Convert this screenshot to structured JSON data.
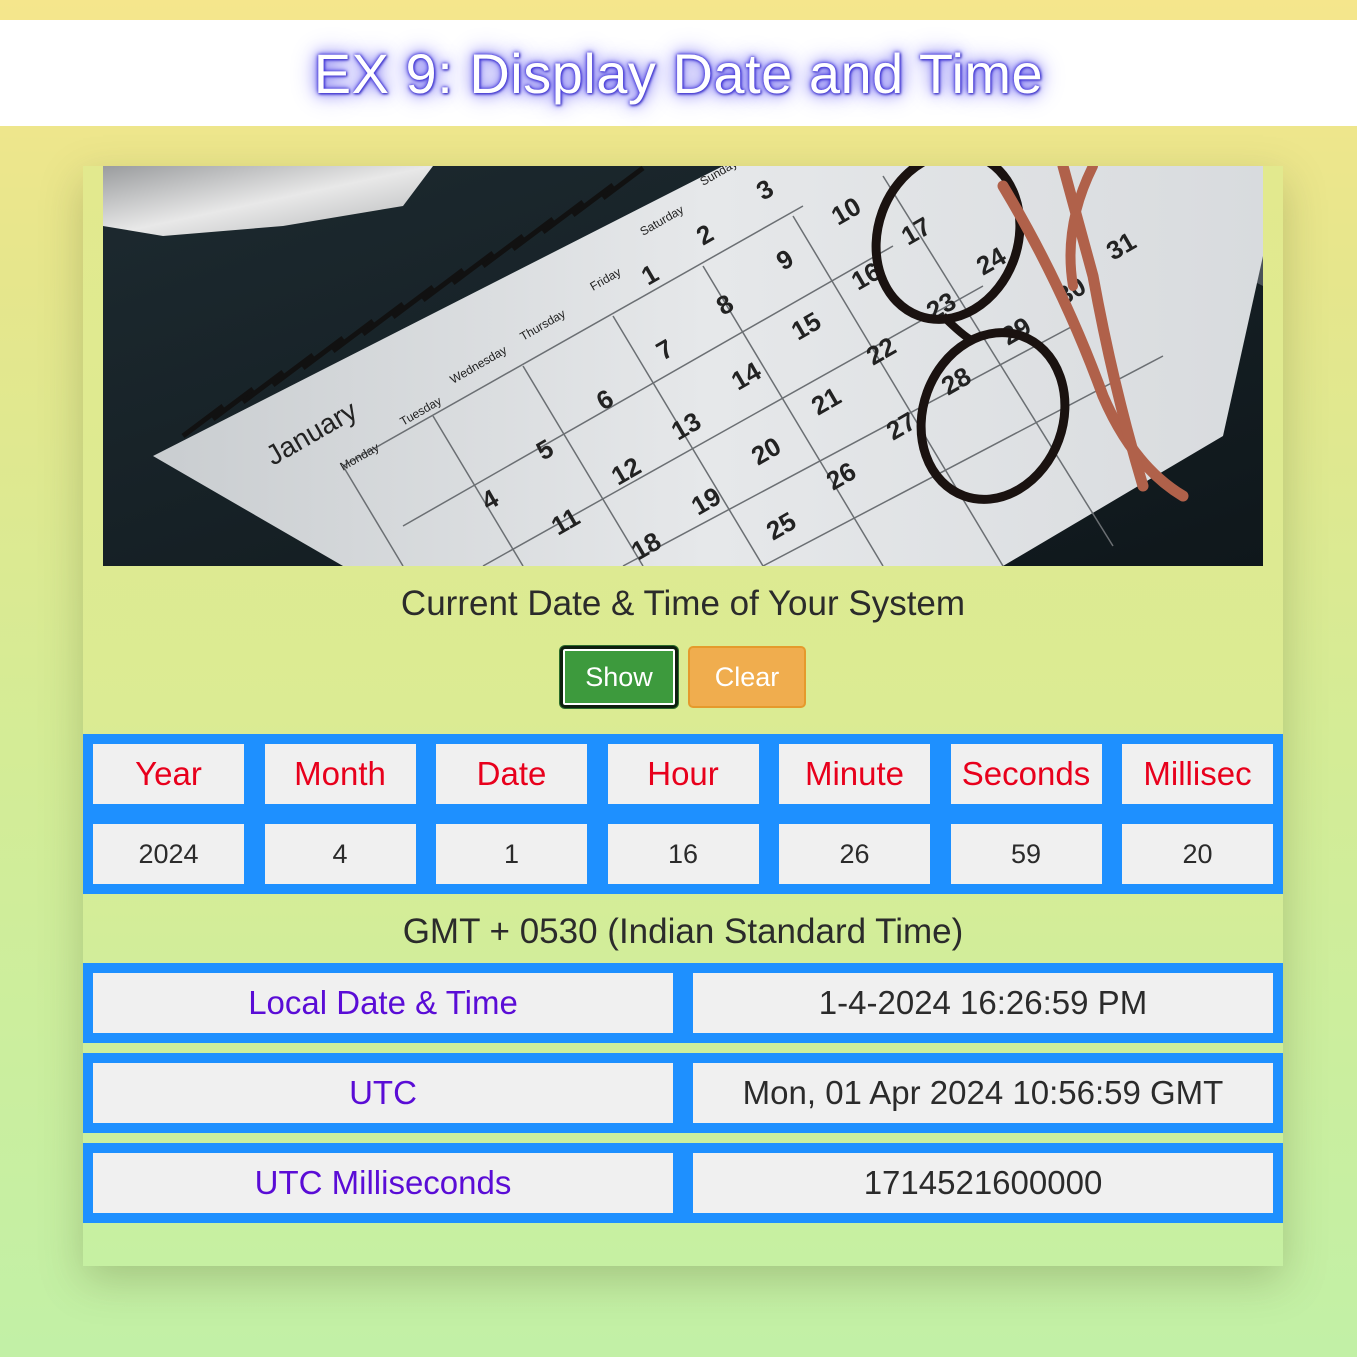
{
  "page": {
    "title": "EX 9: Display Date and Time"
  },
  "photo": {
    "month_label": "January",
    "weekdays": [
      "Monday",
      "Tuesday",
      "Wednesday",
      "Thursday",
      "Friday",
      "Saturday",
      "Sunday"
    ],
    "days": [
      "1",
      "2",
      "3",
      "4",
      "5",
      "6",
      "7",
      "8",
      "9",
      "10",
      "11",
      "12",
      "13",
      "14",
      "15",
      "16",
      "17",
      "18",
      "19",
      "20",
      "21",
      "22",
      "23",
      "24",
      "25",
      "26",
      "27",
      "28",
      "29",
      "30",
      "31"
    ]
  },
  "main": {
    "subtitle": "Current Date & Time of Your System",
    "buttons": {
      "show": "Show",
      "clear": "Clear"
    },
    "table": {
      "headers": [
        "Year",
        "Month",
        "Date",
        "Hour",
        "Minute",
        "Seconds",
        "Millisec"
      ],
      "values": [
        "2024",
        "4",
        "1",
        "16",
        "26",
        "59",
        "20"
      ]
    },
    "timezone": "GMT + 0530 (Indian Standard Time)",
    "info": [
      {
        "label": "Local Date & Time",
        "value": "1-4-2024 16:26:59 PM"
      },
      {
        "label": "UTC",
        "value": "Mon, 01 Apr 2024 10:56:59 GMT"
      },
      {
        "label": "UTC Milliseconds",
        "value": "1714521600000"
      }
    ]
  },
  "colors": {
    "table_border": "#1e90ff",
    "header_text": "#e8001c",
    "label_text": "#5a0cd6",
    "show_button": "#3d9a3d",
    "clear_button": "#f0ad4e"
  }
}
